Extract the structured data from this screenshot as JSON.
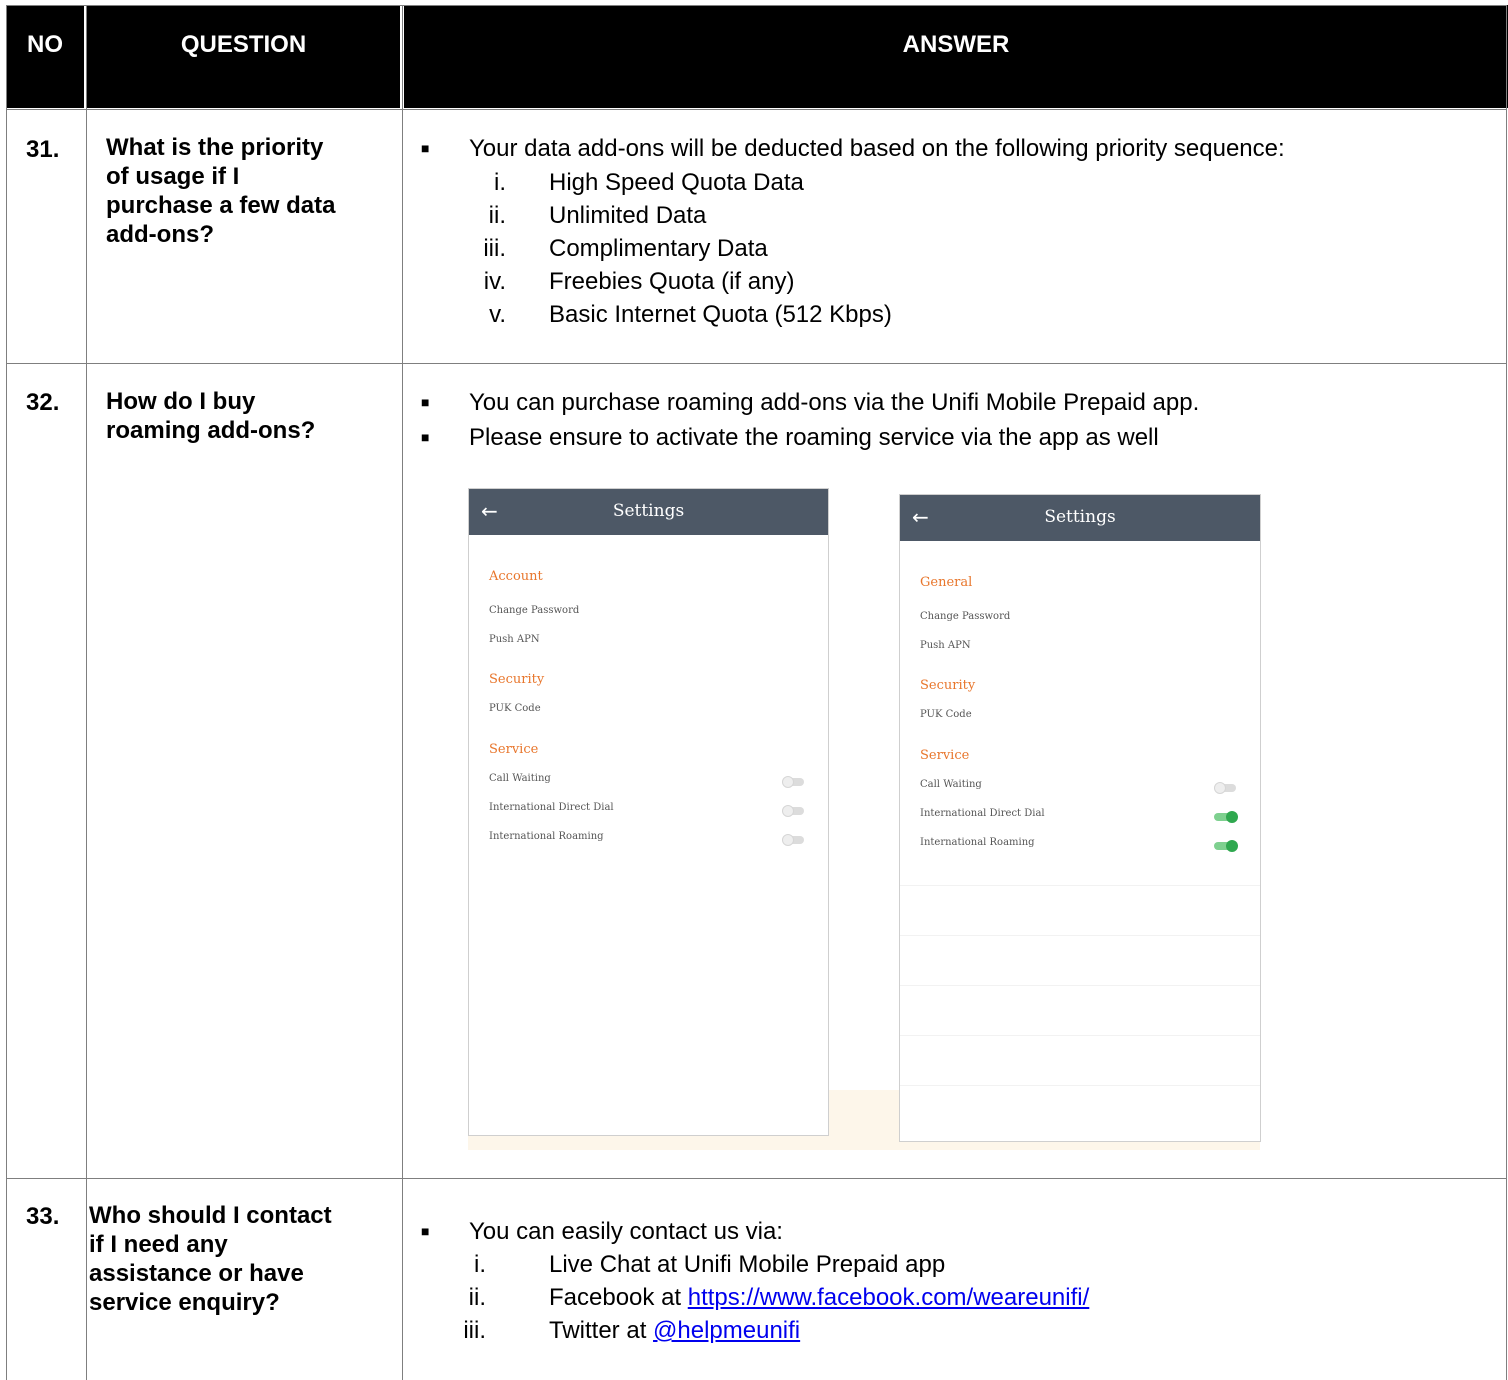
{
  "table": {
    "headers": {
      "no": "NO",
      "question": "QUESTION",
      "answer": "ANSWER"
    }
  },
  "rows": [
    {
      "no": "31.",
      "question": [
        "What is the priority",
        "of usage if I",
        "purchase a few data",
        "add-ons?"
      ],
      "bullets": [
        "Your data add-ons will be deducted based on the following priority sequence:"
      ],
      "list": [
        {
          "n": "i.",
          "t": "High Speed Quota Data"
        },
        {
          "n": "ii.",
          "t": "Unlimited Data"
        },
        {
          "n": "iii.",
          "t": "Complimentary Data"
        },
        {
          "n": "iv.",
          "t": "Freebies Quota (if any)"
        },
        {
          "n": "v.",
          "t": "Basic Internet Quota (512 Kbps)"
        }
      ]
    },
    {
      "no": "32.",
      "question": [
        "How do I buy",
        "roaming add-ons?"
      ],
      "bullets": [
        "You can purchase roaming add-ons via the Unifi Mobile Prepaid app.",
        "Please ensure to activate the roaming service via the app as well"
      ]
    },
    {
      "no": "33.",
      "question": [
        "Who should I contact",
        "if I need any",
        "assistance or have",
        "service enquiry?"
      ],
      "bullets": [
        "You can easily contact us via:"
      ],
      "list": [
        {
          "n": "i.",
          "t": "Live Chat at Unifi Mobile Prepaid app",
          "link": ""
        },
        {
          "n": "ii.",
          "t": "Facebook at ",
          "link": "https://www.facebook.com/weareunifi/"
        },
        {
          "n": "iii.",
          "t": "Twitter at ",
          "link": "@helpmeunifi"
        }
      ]
    }
  ],
  "screens": [
    {
      "title": "Settings",
      "back_icon": "←",
      "sections": [
        "Account",
        "Security",
        "Service"
      ],
      "items": [
        "Change Password",
        "Push APN",
        "PUK Code",
        "Call Waiting",
        "International Direct Dial",
        "International Roaming"
      ],
      "toggles": [
        "off",
        "off",
        "off"
      ]
    },
    {
      "title": "Settings",
      "back_icon": "←",
      "sections": [
        "General",
        "Security",
        "Service"
      ],
      "items": [
        "Change Password",
        "Push APN",
        "PUK Code",
        "Call Waiting",
        "International Direct Dial",
        "International Roaming"
      ],
      "toggles": [
        "off",
        "on",
        "on"
      ]
    }
  ],
  "colors": {
    "header_bg": "#000000",
    "app_bar": "#4d5866",
    "section_label": "#e8762c",
    "toggle_on": "#2fa84f",
    "link": "#0000ee"
  }
}
